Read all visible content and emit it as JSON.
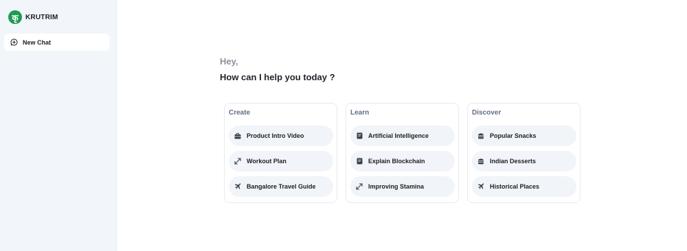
{
  "sidebar": {
    "brand": "KRUTRIM",
    "logo_glyph": "कृ",
    "new_chat_label": "New Chat"
  },
  "main": {
    "greeting": "Hey,",
    "prompt": "How can I help you today ?"
  },
  "cards": [
    {
      "title": "Create",
      "items": [
        {
          "label": "Product Intro Video",
          "icon": "briefcase-icon"
        },
        {
          "label": "Workout Plan",
          "icon": "expand-icon"
        },
        {
          "label": "Bangalore Travel Guide",
          "icon": "airplane-icon"
        }
      ]
    },
    {
      "title": "Learn",
      "items": [
        {
          "label": "Artificial Intelligence",
          "icon": "book-icon"
        },
        {
          "label": "Explain Blockchain",
          "icon": "book-icon"
        },
        {
          "label": "Improving Stamina",
          "icon": "expand-icon"
        }
      ]
    },
    {
      "title": "Discover",
      "items": [
        {
          "label": "Popular Snacks",
          "icon": "food-icon"
        },
        {
          "label": "Indian Desserts",
          "icon": "food-icon"
        },
        {
          "label": "Historical Places",
          "icon": "airplane-icon"
        }
      ]
    }
  ],
  "colors": {
    "brand_green": "#1f9a55",
    "sidebar_bg": "#f2f5fa",
    "chip_bg": "#f1f4f8",
    "card_title": "#5f6f86"
  }
}
